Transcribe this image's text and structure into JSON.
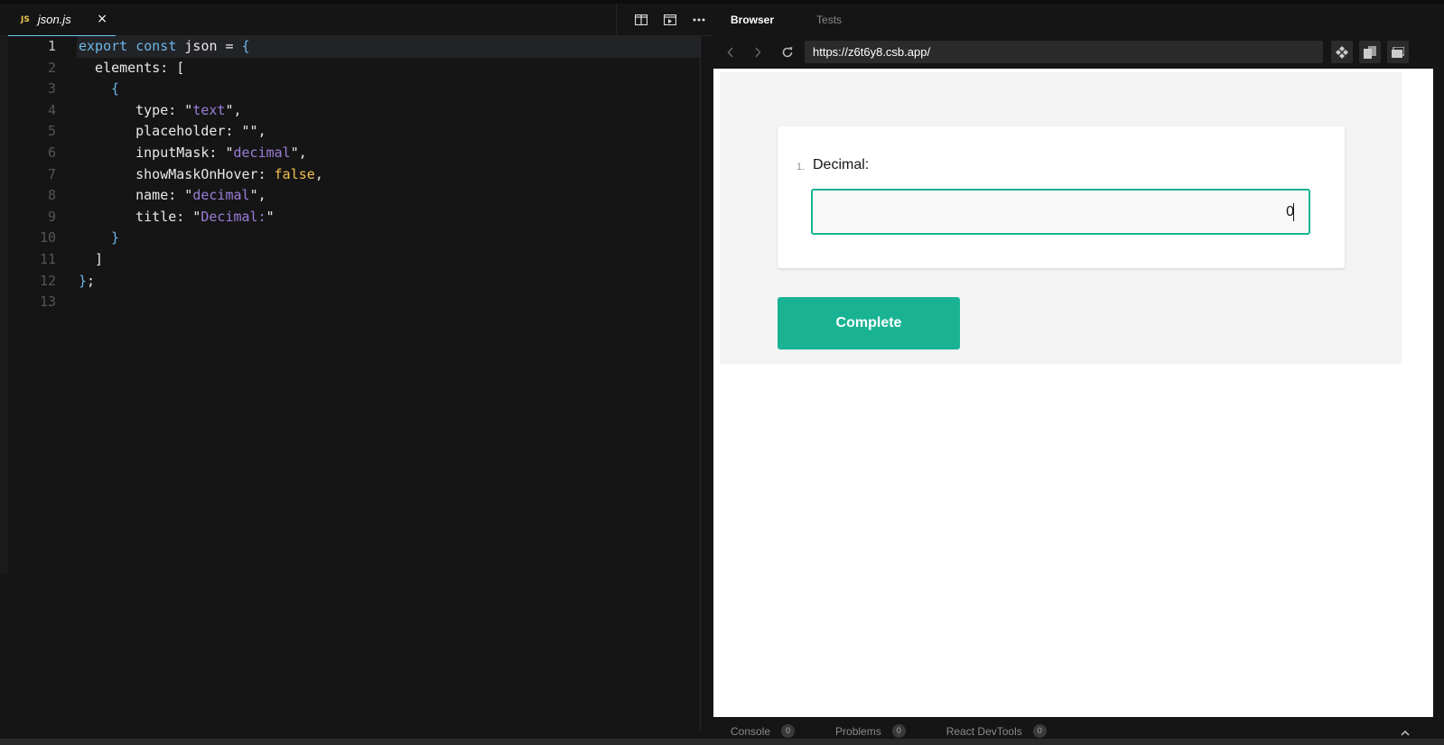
{
  "editor": {
    "tab": {
      "badge": "JS",
      "filename": "json.js",
      "close": "×"
    },
    "line_numbers": [
      "1",
      "2",
      "3",
      "4",
      "5",
      "6",
      "7",
      "8",
      "9",
      "10",
      "11",
      "12",
      "13"
    ],
    "code": {
      "l1_a": "export",
      "l1_b": " ",
      "l1_c": "const",
      "l1_d": " json = ",
      "l1_e": "{",
      "l2": "  elements: [",
      "l3": "{",
      "l4_a": "    type: \"",
      "l4_b": "text",
      "l4_c": "\",",
      "l5": "    placeholder: \"\",",
      "l6_a": "    inputMask: \"",
      "l6_b": "decimal",
      "l6_c": "\",",
      "l7_a": "    showMaskOnHover: ",
      "l7_b": "false",
      "l7_c": ",",
      "l8_a": "    name: \"",
      "l8_b": "decimal",
      "l8_c": "\",",
      "l9_a": "    title: \"",
      "l9_b": "Decimal:",
      "l9_c": "\"",
      "l10": "}",
      "l11": "  ]",
      "l12_a": "}",
      "l12_b": ";"
    }
  },
  "preview": {
    "tabs": [
      "Browser",
      "Tests"
    ],
    "url": "https://z6t6y8.csb.app/",
    "survey": {
      "question_number": "1.",
      "question_title": "Decimal:",
      "input_value": "0",
      "complete_label": "Complete"
    },
    "bottom_tabs": [
      {
        "label": "Console",
        "count": "0"
      },
      {
        "label": "Problems",
        "count": "0"
      },
      {
        "label": "React DevTools",
        "count": "0"
      }
    ]
  }
}
